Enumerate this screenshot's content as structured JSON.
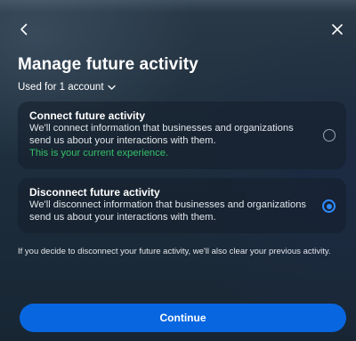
{
  "header": {
    "title": "Manage future activity",
    "back_icon": "chevron-left-icon",
    "close_icon": "close-icon"
  },
  "account_selector": {
    "label": "Used for 1 account",
    "icon": "chevron-down-icon"
  },
  "options": [
    {
      "title": "Connect future activity",
      "description": "We'll connect information that businesses and organizations send us about your interactions with them.",
      "note": "This is your current experience.",
      "selected": false
    },
    {
      "title": "Disconnect future activity",
      "description": "We'll disconnect information that businesses and organizations send us about your interactions with them.",
      "selected": true
    }
  ],
  "footnote": "If you decide to disconnect your future activity, we'll also clear your previous activity.",
  "continue_label": "Continue",
  "colors": {
    "accent": "#0866e0",
    "radio_selected": "#2f8cff",
    "note_green": "#35c06a"
  }
}
